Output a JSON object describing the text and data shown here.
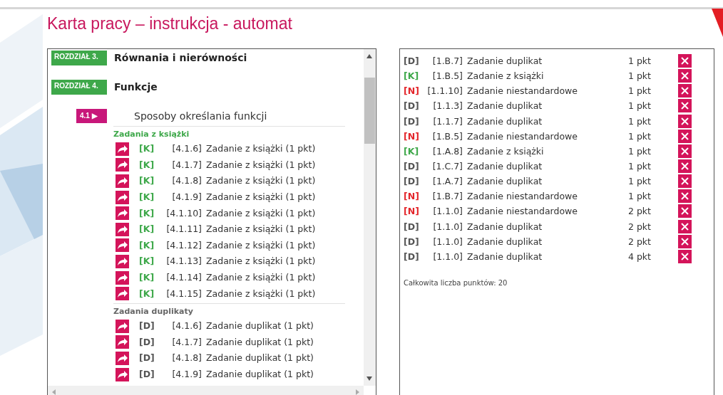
{
  "title": "Karta pracy – instrukcja - automat",
  "chapters": [
    {
      "label": "ROZDZIAŁ 3.",
      "title": "Równania i nierówności"
    },
    {
      "label": "ROZDZIAŁ 4.",
      "title": "Funkcje"
    }
  ],
  "section": {
    "number": "4.1 ▶",
    "title": "Sposoby określania funkcji"
  },
  "groups": [
    {
      "kind": "book",
      "title": "Zadania z książki",
      "tasks": [
        {
          "kind": "book",
          "tag": "[K]",
          "code": "[4.1.6]",
          "text": "Zadanie z książki (1 pkt)"
        },
        {
          "kind": "book",
          "tag": "[K]",
          "code": "[4.1.7]",
          "text": "Zadanie z książki (1 pkt)"
        },
        {
          "kind": "book",
          "tag": "[K]",
          "code": "[4.1.8]",
          "text": "Zadanie z książki (1 pkt)"
        },
        {
          "kind": "book",
          "tag": "[K]",
          "code": "[4.1.9]",
          "text": "Zadanie z książki (1 pkt)"
        },
        {
          "kind": "book",
          "tag": "[K]",
          "code": "[4.1.10]",
          "text": "Zadanie z książki (1 pkt)"
        },
        {
          "kind": "book",
          "tag": "[K]",
          "code": "[4.1.11]",
          "text": "Zadanie z książki (1 pkt)"
        },
        {
          "kind": "book",
          "tag": "[K]",
          "code": "[4.1.12]",
          "text": "Zadanie z książki (1 pkt)"
        },
        {
          "kind": "book",
          "tag": "[K]",
          "code": "[4.1.13]",
          "text": "Zadanie z książki (1 pkt)"
        },
        {
          "kind": "book",
          "tag": "[K]",
          "code": "[4.1.14]",
          "text": "Zadanie z książki (1 pkt)"
        },
        {
          "kind": "book",
          "tag": "[K]",
          "code": "[4.1.15]",
          "text": "Zadanie z książki (1 pkt)"
        }
      ]
    },
    {
      "kind": "duplicate",
      "title": "Zadania duplikaty",
      "tasks": [
        {
          "kind": "duplicate",
          "tag": "[D]",
          "code": "[4.1.6]",
          "text": "Zadanie duplikat (1 pkt)"
        },
        {
          "kind": "duplicate",
          "tag": "[D]",
          "code": "[4.1.7]",
          "text": "Zadanie duplikat (1 pkt)"
        },
        {
          "kind": "duplicate",
          "tag": "[D]",
          "code": "[4.1.8]",
          "text": "Zadanie duplikat (1 pkt)"
        },
        {
          "kind": "duplicate",
          "tag": "[D]",
          "code": "[4.1.9]",
          "text": "Zadanie duplikat (1 pkt)"
        }
      ]
    }
  ],
  "selected_tasks": [
    {
      "kind": "duplicate",
      "tag": "[D]",
      "code": "[1.B.7]",
      "text": "Zadanie duplikat",
      "points": "1 pkt"
    },
    {
      "kind": "book",
      "tag": "[K]",
      "code": "[1.B.5]",
      "text": "Zadanie z książki",
      "points": "1 pkt"
    },
    {
      "kind": "nonstandard",
      "tag": "[N]",
      "code": "[1.1.10]",
      "text": "Zadanie niestandardowe",
      "points": "1 pkt"
    },
    {
      "kind": "duplicate",
      "tag": "[D]",
      "code": "[1.1.3]",
      "text": "Zadanie duplikat",
      "points": "1 pkt"
    },
    {
      "kind": "duplicate",
      "tag": "[D]",
      "code": "[1.1.7]",
      "text": "Zadanie duplikat",
      "points": "1 pkt"
    },
    {
      "kind": "nonstandard",
      "tag": "[N]",
      "code": "[1.B.5]",
      "text": "Zadanie niestandardowe",
      "points": "1 pkt"
    },
    {
      "kind": "book",
      "tag": "[K]",
      "code": "[1.A.8]",
      "text": "Zadanie z książki",
      "points": "1 pkt"
    },
    {
      "kind": "duplicate",
      "tag": "[D]",
      "code": "[1.C.7]",
      "text": "Zadanie duplikat",
      "points": "1 pkt"
    },
    {
      "kind": "duplicate",
      "tag": "[D]",
      "code": "[1.A.7]",
      "text": "Zadanie duplikat",
      "points": "1 pkt"
    },
    {
      "kind": "nonstandard",
      "tag": "[N]",
      "code": "[1.B.7]",
      "text": "Zadanie niestandardowe",
      "points": "1 pkt"
    },
    {
      "kind": "nonstandard",
      "tag": "[N]",
      "code": "[1.1.0]",
      "text": "Zadanie niestandardowe",
      "points": "2 pkt"
    },
    {
      "kind": "duplicate",
      "tag": "[D]",
      "code": "[1.1.0]",
      "text": "Zadanie duplikat",
      "points": "2 pkt"
    },
    {
      "kind": "duplicate",
      "tag": "[D]",
      "code": "[1.1.0]",
      "text": "Zadanie duplikat",
      "points": "2 pkt"
    },
    {
      "kind": "duplicate",
      "tag": "[D]",
      "code": "[1.1.0]",
      "text": "Zadanie duplikat",
      "points": "4 pkt"
    }
  ],
  "total": "Całkowita liczba punktów: 20"
}
